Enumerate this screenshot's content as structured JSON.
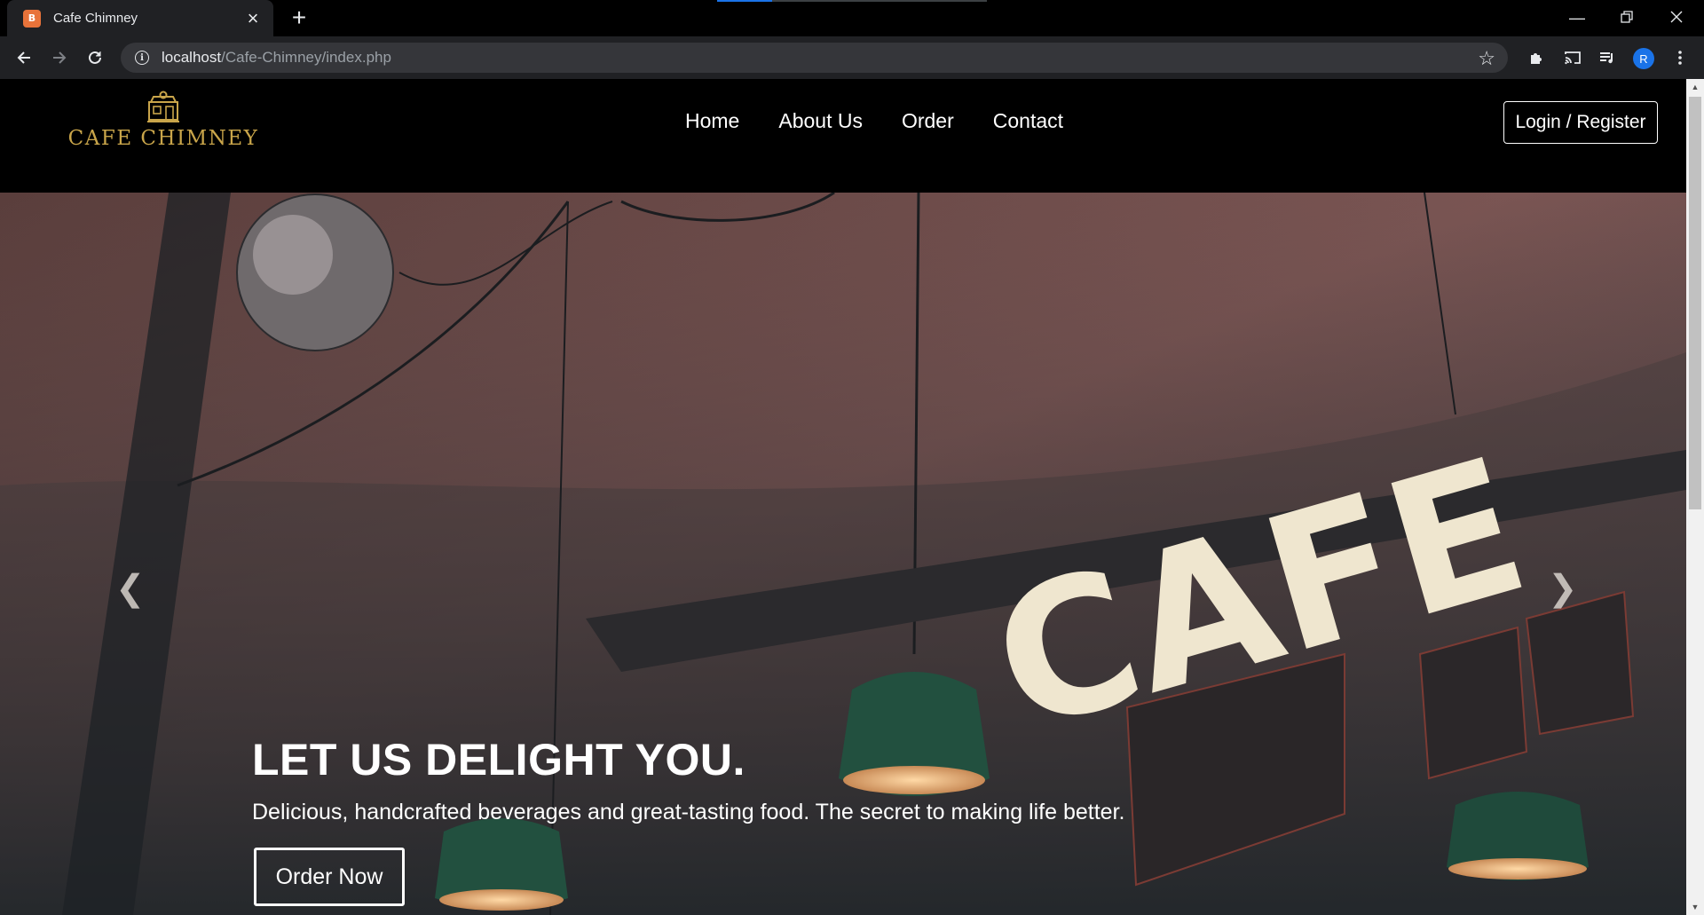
{
  "browser": {
    "tab_title": "Cafe Chimney",
    "tab_favicon_text": "B",
    "url_host": "localhost",
    "url_path": "/Cafe-Chimney/index.php",
    "profile_initial": "R",
    "icons": {
      "back": "back-arrow-icon",
      "forward": "forward-arrow-icon",
      "reload": "reload-icon",
      "info": "info-icon",
      "star": "star-icon",
      "extensions": "puzzle-icon",
      "cast": "cast-icon",
      "media": "media-queue-icon",
      "menu": "kebab-menu-icon",
      "new_tab": "plus-icon",
      "close_tab": "close-icon",
      "minimize": "minimize-icon",
      "restore": "restore-icon",
      "close_window": "close-icon"
    }
  },
  "site": {
    "brand": "CAFE CHIMNEY",
    "nav": [
      {
        "label": "Home"
      },
      {
        "label": "About Us"
      },
      {
        "label": "Order"
      },
      {
        "label": "Contact"
      }
    ],
    "login_label": "Login / Register"
  },
  "hero": {
    "title": "LET US DELIGHT YOU.",
    "subtitle": "Delicious, handcrafted beverages and great-tasting food. The secret to making life better.",
    "cta_label": "Order Now",
    "prev_icon": "chevron-left-icon",
    "next_icon": "chevron-right-icon"
  },
  "colors": {
    "brand_gold": "#c9a54a",
    "header_bg": "#000000",
    "chrome_bg": "#202124"
  }
}
